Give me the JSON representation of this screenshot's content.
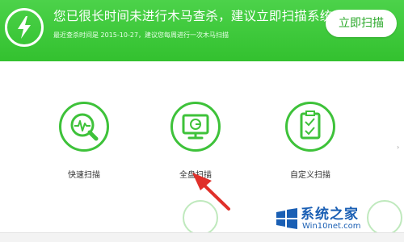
{
  "banner": {
    "title": "您已很长时间未进行木马查杀，建议立即扫描系统",
    "subtitle": "最近查杀时间是 2015-10-27，建议您每周进行一次木马扫描",
    "scan_button": "立即扫描",
    "accent": "#3ec23a"
  },
  "options": [
    {
      "label": "快速扫描",
      "icon": "quick-scan-icon"
    },
    {
      "label": "全盘扫描",
      "icon": "full-scan-icon"
    },
    {
      "label": "自定义扫描",
      "icon": "custom-scan-icon"
    }
  ],
  "watermark": {
    "title": "系统之家",
    "subtitle": "Win10net.com",
    "color": "#1a5fb4"
  }
}
